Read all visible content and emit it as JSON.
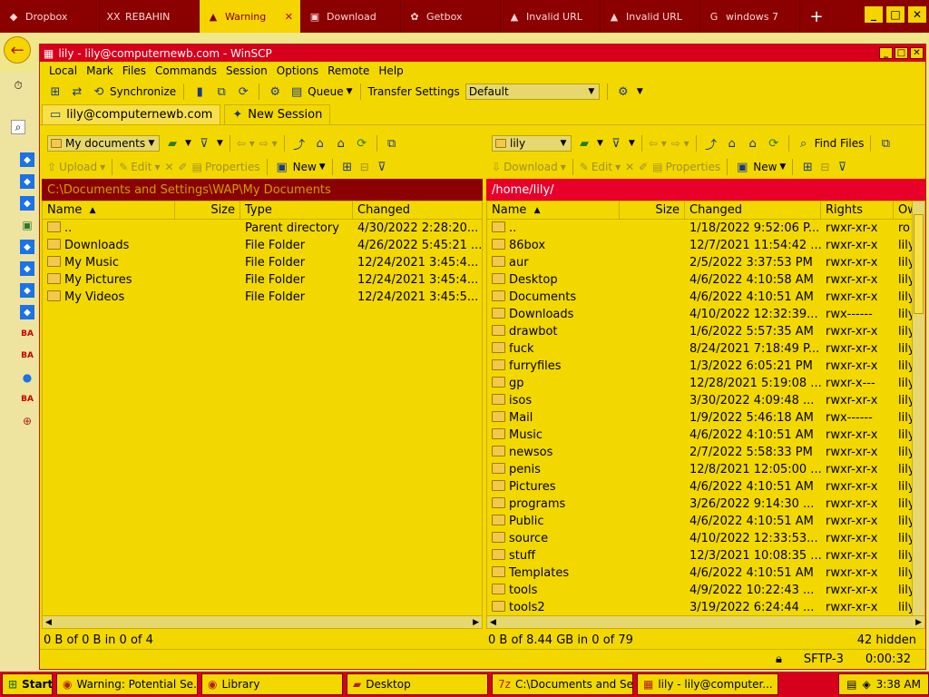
{
  "browser": {
    "tabs": [
      {
        "label": "Dropbox",
        "icon": "dropbox-icon",
        "active": false
      },
      {
        "label": "REBAHIN",
        "icon": "xxi-icon",
        "active": false
      },
      {
        "label": "Warning",
        "icon": "warning-icon",
        "active": true
      },
      {
        "label": "Download",
        "icon": "download-icon",
        "active": false
      },
      {
        "label": "Getbox",
        "icon": "gear-icon",
        "active": false
      },
      {
        "label": "Invalid URL",
        "icon": "warning-icon",
        "active": false
      },
      {
        "label": "Invalid URL",
        "icon": "warning-icon",
        "active": false
      },
      {
        "label": "windows 7",
        "icon": "google-icon",
        "active": false
      }
    ],
    "search_partial": "p"
  },
  "winscp": {
    "title": "lily - lily@computernewb.com - WinSCP",
    "menu": [
      "Local",
      "Mark",
      "Files",
      "Commands",
      "Session",
      "Options",
      "Remote",
      "Help"
    ],
    "toolbar": {
      "synchronize": "Synchronize",
      "queue": "Queue",
      "transfer_settings_label": "Transfer Settings",
      "transfer_settings_value": "Default"
    },
    "session_tabs": [
      {
        "label": "lily@computernewb.com",
        "active": true
      },
      {
        "label": "New Session",
        "active": false
      }
    ],
    "left": {
      "location": "My documents",
      "upload": "Upload",
      "edit": "Edit",
      "properties": "Properties",
      "new": "New",
      "path": "C:\\Documents and Settings\\WAP\\My Documents",
      "columns": [
        "Name",
        "Size",
        "Type",
        "Changed"
      ],
      "rows": [
        {
          "name": "..",
          "size": "",
          "type": "Parent directory",
          "changed": "4/30/2022  2:28:20..."
        },
        {
          "name": "Downloads",
          "size": "",
          "type": "File Folder",
          "changed": "4/26/2022  5:45:21 ..."
        },
        {
          "name": "My Music",
          "size": "",
          "type": "File Folder",
          "changed": "12/24/2021  3:45:4..."
        },
        {
          "name": "My Pictures",
          "size": "",
          "type": "File Folder",
          "changed": "12/24/2021  3:45:4..."
        },
        {
          "name": "My Videos",
          "size": "",
          "type": "File Folder",
          "changed": "12/24/2021  3:45:5..."
        }
      ],
      "status": "0 B of 0 B in 0 of 4"
    },
    "right": {
      "location": "lily",
      "find_files": "Find Files",
      "download": "Download",
      "edit": "Edit",
      "properties": "Properties",
      "new": "New",
      "path": "/home/lily/",
      "columns": [
        "Name",
        "Size",
        "Changed",
        "Rights",
        "Ow"
      ],
      "rows": [
        {
          "name": "..",
          "changed": "1/18/2022  9:52:06 P...",
          "rights": "rwxr-xr-x",
          "owner": "ro"
        },
        {
          "name": "86box",
          "changed": "12/7/2021  11:54:42 ...",
          "rights": "rwxr-xr-x",
          "owner": "lily"
        },
        {
          "name": "aur",
          "changed": "2/5/2022  3:37:53 PM",
          "rights": "rwxr-xr-x",
          "owner": "lily"
        },
        {
          "name": "Desktop",
          "changed": "4/6/2022  4:10:58 AM",
          "rights": "rwxr-xr-x",
          "owner": "lily"
        },
        {
          "name": "Documents",
          "changed": "4/6/2022  4:10:51 AM",
          "rights": "rwxr-xr-x",
          "owner": "lily"
        },
        {
          "name": "Downloads",
          "changed": "4/10/2022  12:32:39...",
          "rights": "rwx------",
          "owner": "lily"
        },
        {
          "name": "drawbot",
          "changed": "1/6/2022  5:57:35 AM",
          "rights": "rwxr-xr-x",
          "owner": "lily"
        },
        {
          "name": "fuck",
          "changed": "8/24/2021  7:18:49 P...",
          "rights": "rwxr-xr-x",
          "owner": "lily"
        },
        {
          "name": "furryfiles",
          "changed": "1/3/2022  6:05:21 PM",
          "rights": "rwxr-xr-x",
          "owner": "lily"
        },
        {
          "name": "gp",
          "changed": "12/28/2021  5:19:08 ...",
          "rights": "rwxr-x---",
          "owner": "lily"
        },
        {
          "name": "isos",
          "changed": "3/30/2022  4:09:48 ...",
          "rights": "rwxr-xr-x",
          "owner": "lily"
        },
        {
          "name": "Mail",
          "changed": "1/9/2022  5:46:18 AM",
          "rights": "rwx------",
          "owner": "lily"
        },
        {
          "name": "Music",
          "changed": "4/6/2022  4:10:51 AM",
          "rights": "rwxr-xr-x",
          "owner": "lily"
        },
        {
          "name": "newsos",
          "changed": "2/7/2022  5:58:33 PM",
          "rights": "rwxr-xr-x",
          "owner": "lily"
        },
        {
          "name": "penis",
          "changed": "12/8/2021  12:05:00 ...",
          "rights": "rwxr-xr-x",
          "owner": "lily"
        },
        {
          "name": "Pictures",
          "changed": "4/6/2022  4:10:51 AM",
          "rights": "rwxr-xr-x",
          "owner": "lily"
        },
        {
          "name": "programs",
          "changed": "3/26/2022  9:14:30 ...",
          "rights": "rwxr-xr-x",
          "owner": "lily"
        },
        {
          "name": "Public",
          "changed": "4/6/2022  4:10:51 AM",
          "rights": "rwxr-xr-x",
          "owner": "lily"
        },
        {
          "name": "source",
          "changed": "4/10/2022  12:33:53...",
          "rights": "rwxr-xr-x",
          "owner": "lily"
        },
        {
          "name": "stuff",
          "changed": "12/3/2021  10:08:35 ...",
          "rights": "rwxr-xr-x",
          "owner": "lily"
        },
        {
          "name": "Templates",
          "changed": "4/6/2022  4:10:51 AM",
          "rights": "rwxr-xr-x",
          "owner": "lily"
        },
        {
          "name": "tools",
          "changed": "4/9/2022  10:22:43 ...",
          "rights": "rwxr-xr-x",
          "owner": "lily"
        },
        {
          "name": "tools2",
          "changed": "3/19/2022  6:24:44 ...",
          "rights": "rwxr-xr-x",
          "owner": "lily"
        }
      ],
      "status": "0 B of 8.44 GB in 0 of 79",
      "hidden": "42 hidden"
    },
    "protocol": "SFTP-3",
    "elapsed": "0:00:32"
  },
  "taskbar": {
    "start": "Start",
    "items": [
      {
        "label": "Warning: Potential Se...",
        "icon": "firefox-icon"
      },
      {
        "label": "Library",
        "icon": "firefox-icon"
      },
      {
        "label": "Desktop",
        "icon": "folder-icon"
      },
      {
        "label": "C:\\Documents and Set...",
        "icon": "7zip-icon"
      },
      {
        "label": "lily - lily@computer...",
        "icon": "winscp-icon"
      }
    ],
    "time": "3:38 AM"
  },
  "colors": {
    "title_red": "#d6001c",
    "panel_yellow": "#f3d800",
    "inactive_path": "#8b0000"
  }
}
